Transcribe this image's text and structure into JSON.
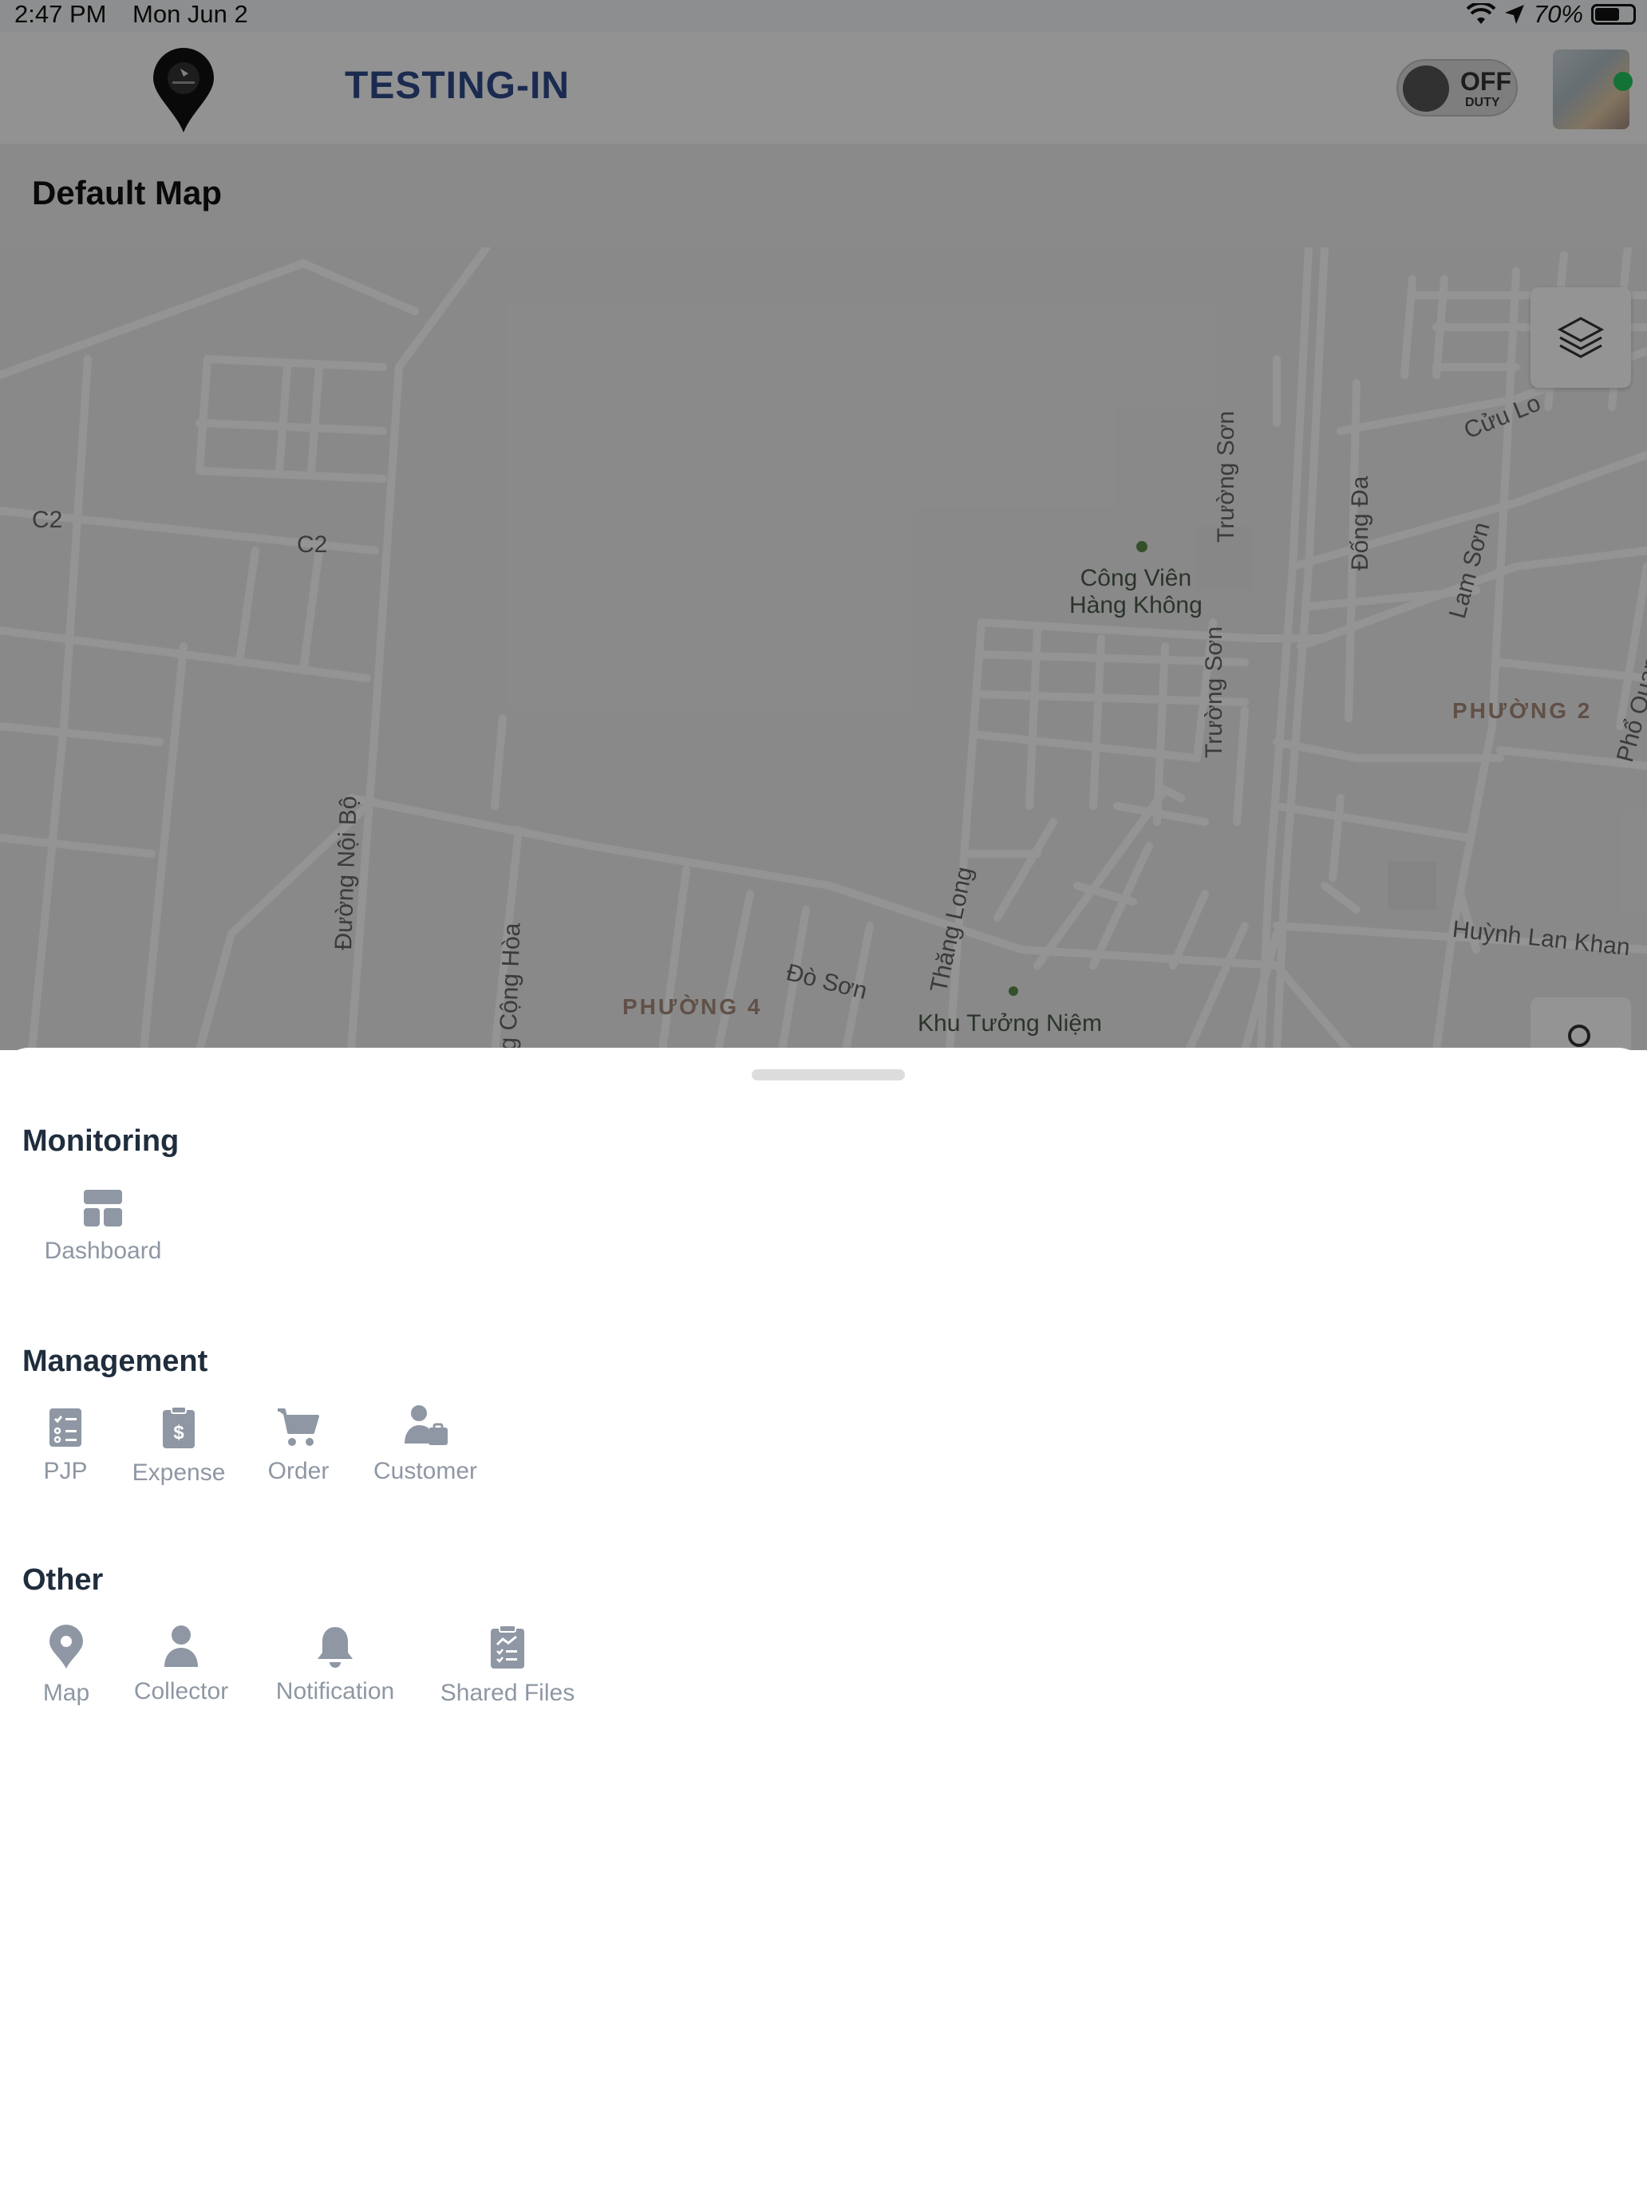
{
  "status_bar": {
    "time": "2:47 PM",
    "date": "Mon Jun 2",
    "battery": "70%"
  },
  "header": {
    "app_title": "TESTING-IN",
    "duty_label": "OFF",
    "duty_sub": "DUTY",
    "status_color": "#22c55e"
  },
  "map": {
    "title": "Default Map",
    "labels": {
      "c2_left": "C2",
      "c2_mid": "C2",
      "park_line1": "Công Viên",
      "park_line2": "Hàng Không",
      "truong_son_1": "Trường Sơn",
      "truong_son_2": "Trường Sơn",
      "dong_da": "Đống Đa",
      "lam_son": "Lam Sơn",
      "cuu_long": "Cửu Lo",
      "ward_2": "PHƯỜNG 2",
      "pho_quang": "Phổ Quang",
      "huynh_lan_khanh": "Huỳnh Lan Khan",
      "thang_long": "Thăng Long",
      "noi_bo": "Đường Nội Bộ",
      "cong_hoa": "g Cộng Hòa",
      "ward_4": "PHƯỜNG 4",
      "do_son": "Đò Sơn",
      "khu_tuong_niem": "Khu Tưởng Niệm"
    }
  },
  "menu": {
    "monitoring": {
      "title": "Monitoring",
      "items": [
        {
          "label": "Dashboard",
          "icon": "dashboard-icon"
        }
      ]
    },
    "management": {
      "title": "Management",
      "items": [
        {
          "label": "PJP",
          "icon": "checklist-icon"
        },
        {
          "label": "Expense",
          "icon": "dollar-clipboard-icon"
        },
        {
          "label": "Order",
          "icon": "cart-icon"
        },
        {
          "label": "Customer",
          "icon": "user-briefcase-icon"
        }
      ]
    },
    "other": {
      "title": "Other",
      "items": [
        {
          "label": "Map",
          "icon": "map-pin-icon"
        },
        {
          "label": "Collector",
          "icon": "user-icon"
        },
        {
          "label": "Notification",
          "icon": "bell-icon"
        },
        {
          "label": "Shared Files",
          "icon": "clipboard-chart-icon"
        }
      ]
    }
  },
  "colors": {
    "icon": "#8e97a3",
    "section_title": "#1f2d3d",
    "brand_title": "#2f4a8a"
  }
}
